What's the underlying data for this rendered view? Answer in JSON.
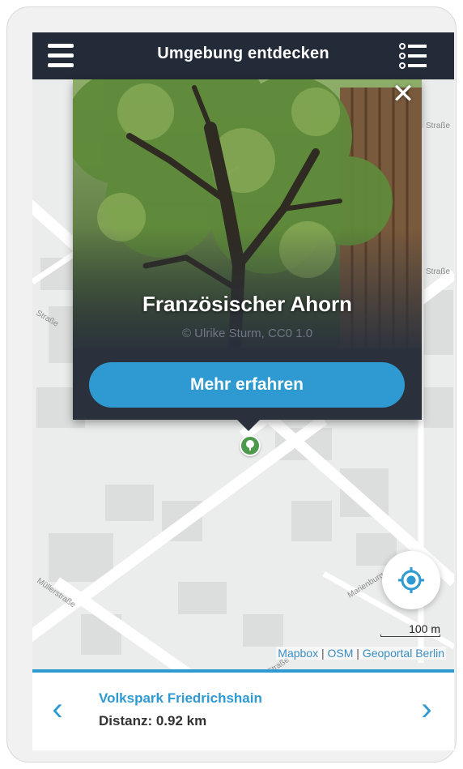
{
  "header": {
    "title": "Umgebung entdecken",
    "menu_icon": "hamburger-icon",
    "list_icon": "list-icon"
  },
  "popup": {
    "name": "Französischer Ahorn",
    "credit": "© Ulrike Sturm, CC0 1.0",
    "button_label": "Mehr erfahren",
    "close_label": "✕"
  },
  "map": {
    "scale_label": "100 m",
    "attribution": {
      "mapbox": "Mapbox",
      "sep1": "|",
      "osm": "OSM",
      "sep2": "|",
      "geoportal": "Geoportal Berlin"
    },
    "street_labels": [
      "Straße",
      "Straße",
      "Straße",
      "Marienburger Straße",
      "Müllerstraße",
      "Erich-Weinert-Straße"
    ]
  },
  "bottom": {
    "prev_label": "‹",
    "next_label": "›",
    "park_name": "Volkspark Friedrichshain",
    "distance": "Distanz: 0.92 km"
  },
  "colors": {
    "header_bg": "#242b38",
    "accent": "#2f9ad1",
    "pin": "#4e9a4c"
  }
}
